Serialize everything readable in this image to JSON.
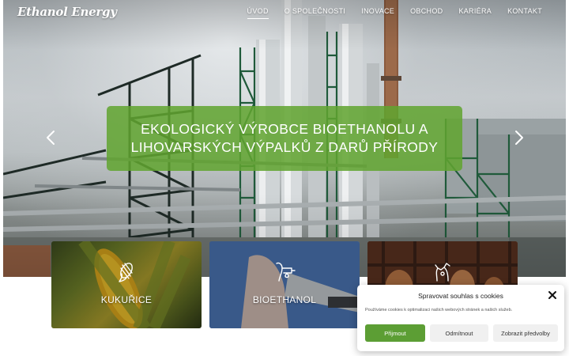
{
  "header": {
    "logo": "Ethanol Energy",
    "nav": [
      {
        "label": "ÚVOD",
        "active": true
      },
      {
        "label": "O SPOLEČNOSTI",
        "active": false
      },
      {
        "label": "INOVACE",
        "active": false
      },
      {
        "label": "OBCHOD",
        "active": false
      },
      {
        "label": "KARIÉRA",
        "active": false
      },
      {
        "label": "KONTAKT",
        "active": false
      }
    ]
  },
  "hero": {
    "slogan": "EKOLOGICKÝ VÝROBCE BIOETHANOLU A LIHOVARSKÝCH VÝPALKŮ Z DARŮ PŘÍRODY",
    "prev_icon": "chevron-left-icon",
    "next_icon": "chevron-right-icon"
  },
  "cards": [
    {
      "label": "KUKUŘICE",
      "icon": "corn-icon"
    },
    {
      "label": "BIOETHANOL",
      "icon": "fuel-pump-icon"
    },
    {
      "label": "",
      "icon": "cow-icon"
    }
  ],
  "cookie": {
    "title": "Spravovat souhlas s cookies",
    "text": "Používáme cookies k optimalizaci našich webových stránek a našich služeb.",
    "accept": "Přijmout",
    "reject": "Odmítnout",
    "preferences": "Zobrazit předvolby",
    "accent": "#5c9e34"
  },
  "colors": {
    "brand_green": "#61a430",
    "text_on_dark": "#ffffff"
  }
}
